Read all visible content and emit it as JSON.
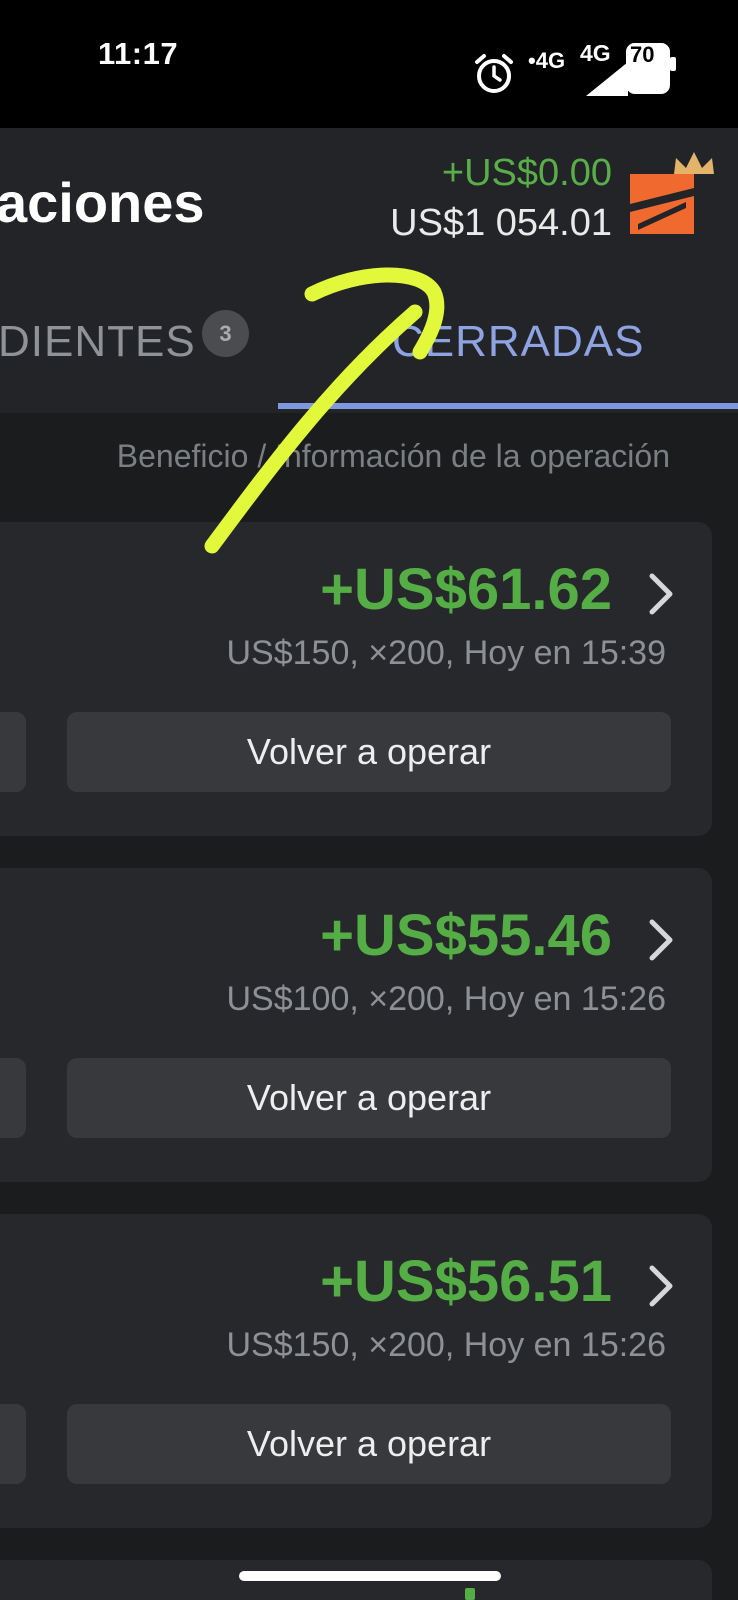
{
  "status_bar": {
    "time": "11:17",
    "network_small": "•4G",
    "network": "4G",
    "battery": "70",
    "icons": [
      "alarm-icon",
      "signal-icon",
      "battery-icon"
    ]
  },
  "header": {
    "title": "aciones",
    "pnl_today": "+US$0.00",
    "balance": "US$1 054.01",
    "logo_icon": "account-crown-logo"
  },
  "tabs": {
    "pending_label": "DIENTES",
    "pending_count": "3",
    "closed_label": "CERRADAS",
    "active": "closed"
  },
  "list": {
    "column_header": "Beneficio / Información de la operación",
    "trades": [
      {
        "profit": "+US$61.62",
        "info": "US$150, ×200, Hoy en 15:39",
        "button": "Volver a operar"
      },
      {
        "profit": "+US$55.46",
        "info": "US$100, ×200, Hoy en 15:26",
        "button": "Volver a operar"
      },
      {
        "profit": "+US$56.51",
        "info": "US$150, ×200, Hoy en 15:26",
        "button": "Volver a operar"
      }
    ]
  },
  "colors": {
    "profit_green": "#55ad45",
    "tab_active": "#8ea3e2",
    "annotation": "#e2f93b",
    "logo_orange": "#f06a2f",
    "crown": "#e3b36a"
  }
}
